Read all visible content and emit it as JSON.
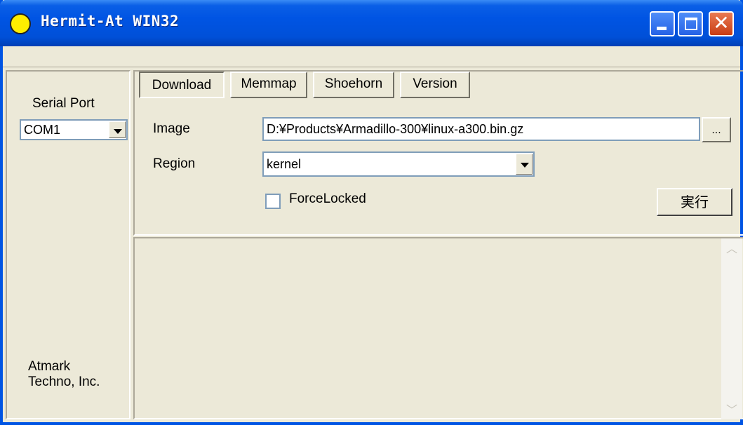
{
  "window": {
    "title": "Hermit-At WIN32",
    "icons": {
      "app": "yellow-circle-icon",
      "minimize": "minimize-icon",
      "maximize": "maximize-icon",
      "close": "close-icon"
    },
    "close_glyph": "✕"
  },
  "sidebar": {
    "serial_port_label": "Serial Port",
    "serial_port_value": "COM1",
    "company_line1": "Atmark",
    "company_line2": "Techno, Inc."
  },
  "tabs": [
    {
      "label": "Download",
      "active": true
    },
    {
      "label": "Memmap",
      "active": false
    },
    {
      "label": "Shoehorn",
      "active": false
    },
    {
      "label": "Version",
      "active": false
    }
  ],
  "download": {
    "image_label": "Image",
    "image_value": "D:¥Products¥Armadillo-300¥linux-a300.bin.gz",
    "browse_label": "...",
    "region_label": "Region",
    "region_value": "kernel",
    "force_locked_label": "ForceLocked",
    "force_locked_checked": false,
    "execute_label": "実行"
  },
  "output": {
    "scroll_up": "︿",
    "scroll_down": "﹀"
  },
  "colors": {
    "titlebar": "#0054e3",
    "face": "#ece9d8",
    "field_border": "#7f9db9"
  }
}
